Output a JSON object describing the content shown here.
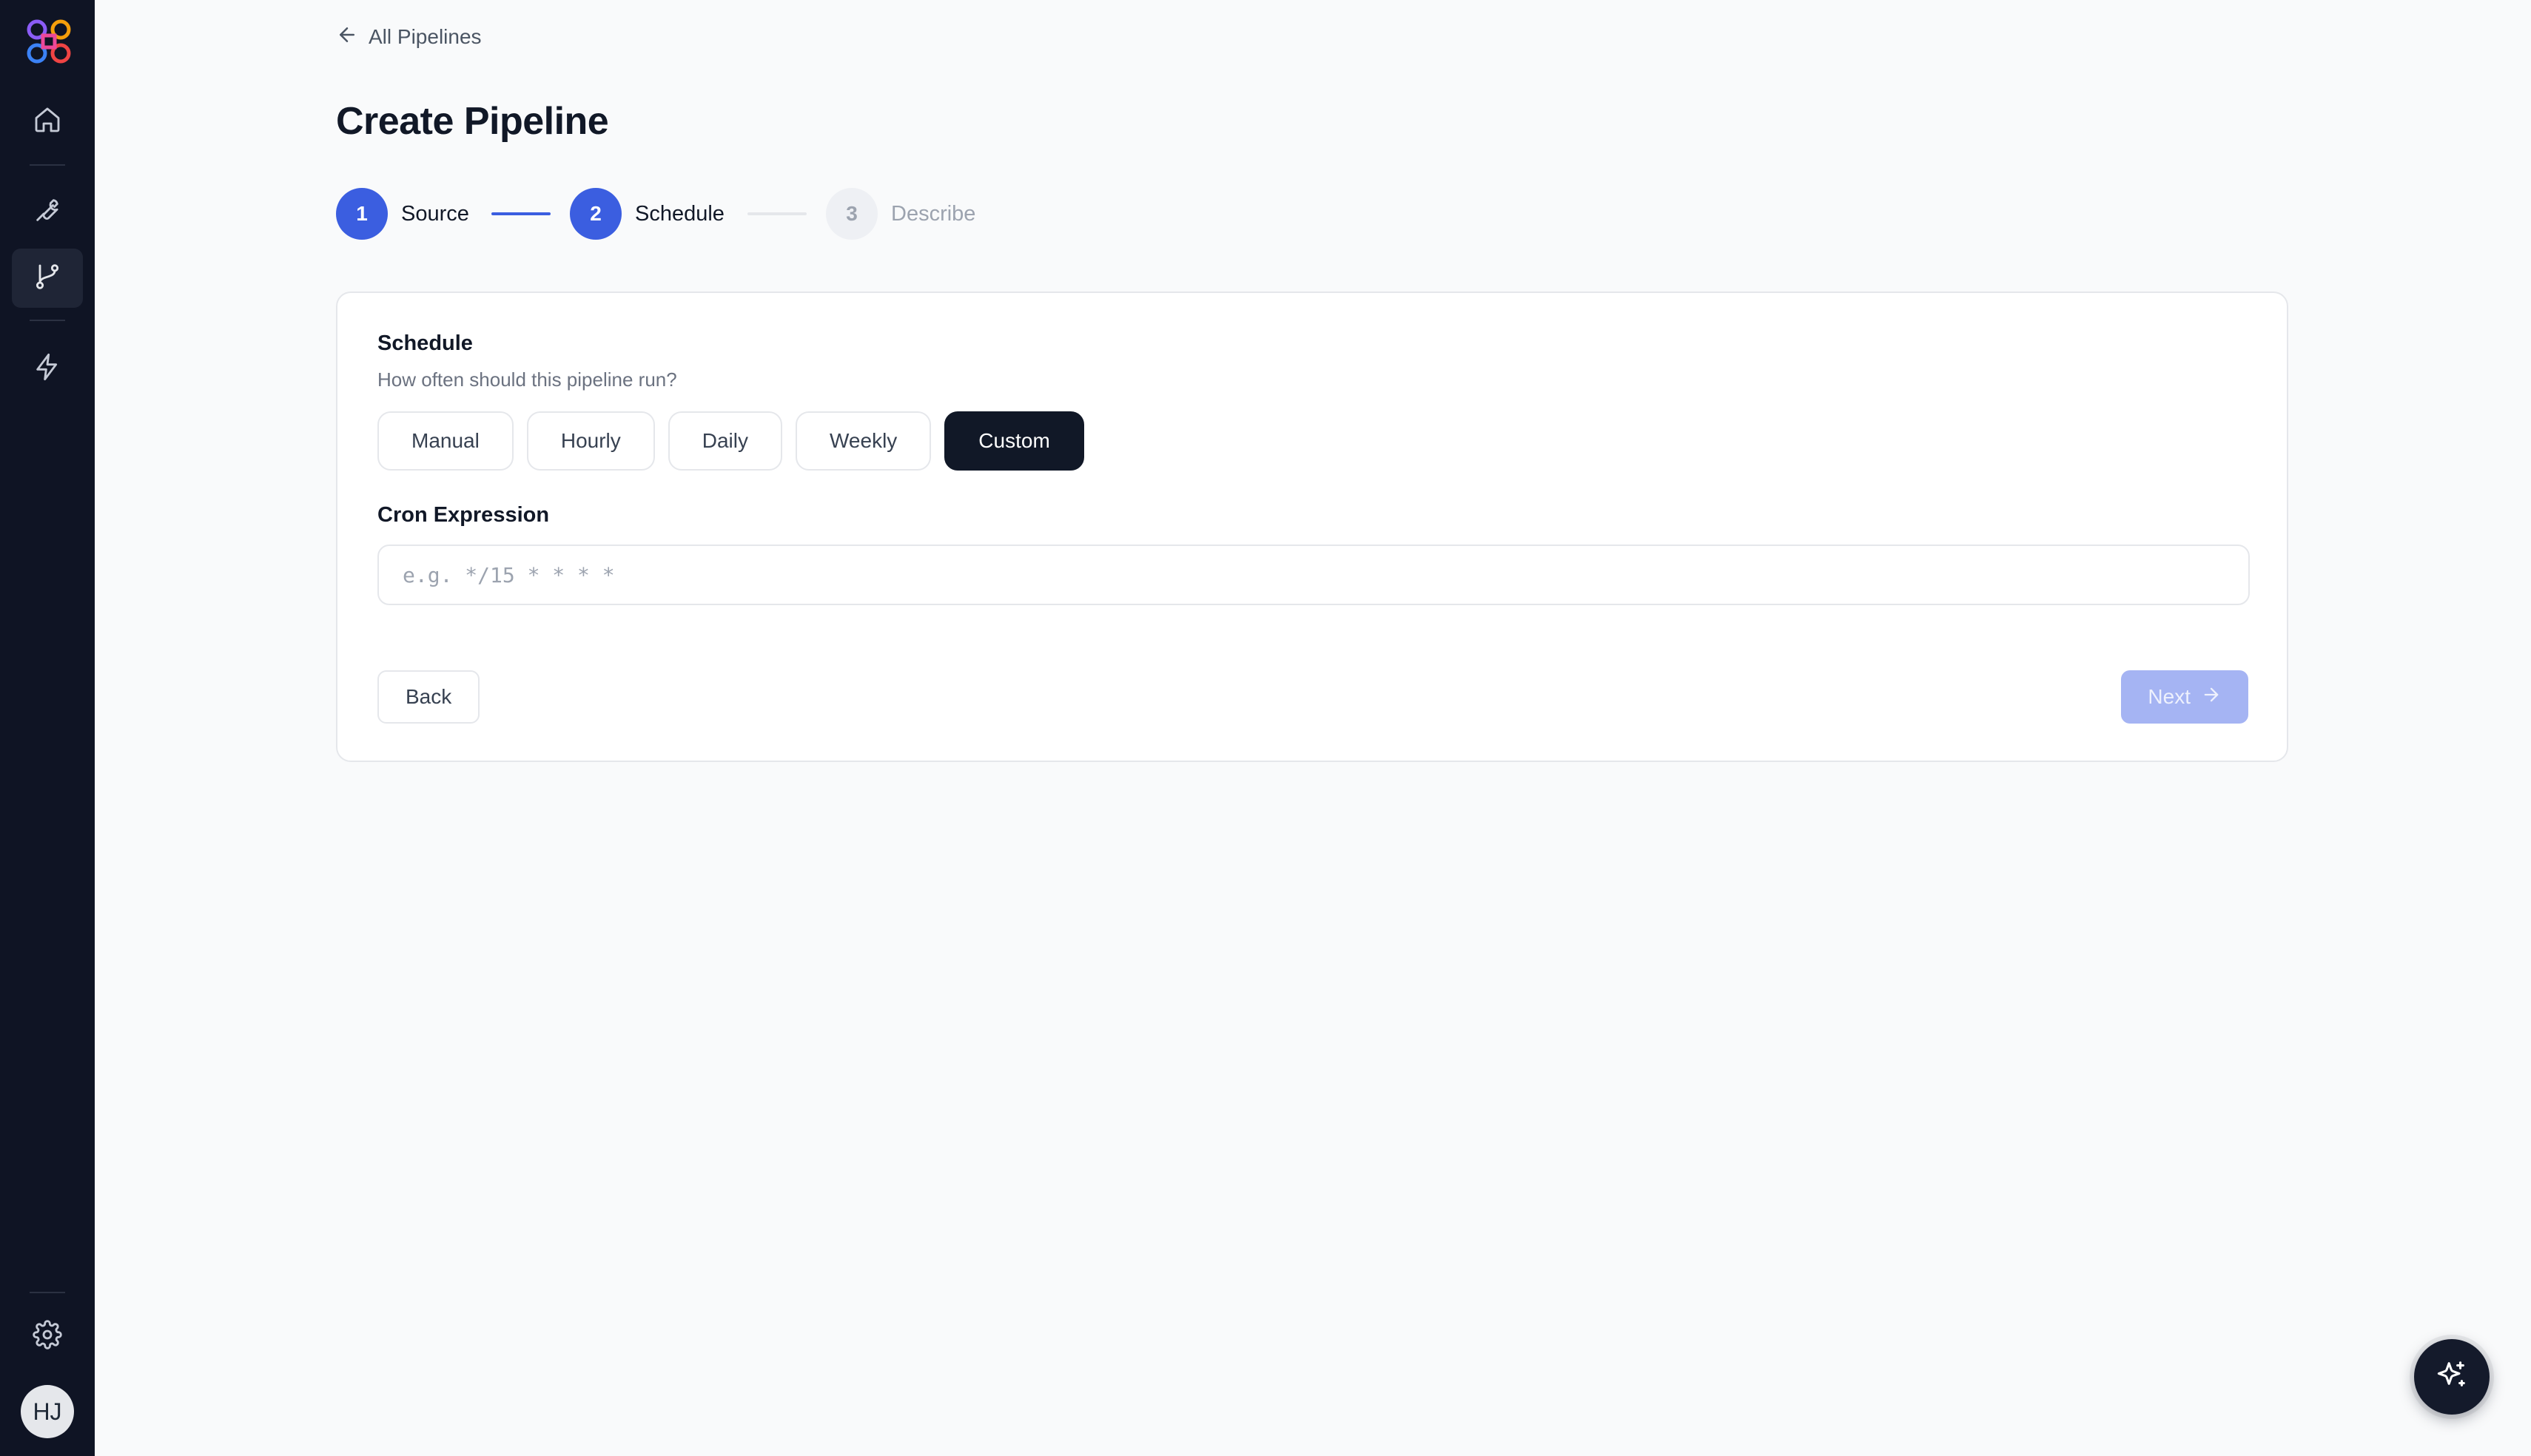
{
  "sidebar": {
    "icons": [
      "logo-icon",
      "home-icon",
      "wrench-icon",
      "git-branch-icon",
      "lightning-icon",
      "gear-icon"
    ],
    "active": "git-branch-icon",
    "avatar_initials": "HJ"
  },
  "header": {
    "back_link": "All Pipelines",
    "title": "Create Pipeline"
  },
  "stepper": {
    "steps": [
      {
        "number": "1",
        "label": "Source",
        "state": "completed"
      },
      {
        "number": "2",
        "label": "Schedule",
        "state": "current"
      },
      {
        "number": "3",
        "label": "Describe",
        "state": "pending"
      }
    ]
  },
  "schedule": {
    "title": "Schedule",
    "subtitle": "How often should this pipeline run?",
    "options": [
      "Manual",
      "Hourly",
      "Daily",
      "Weekly",
      "Custom"
    ],
    "selected": "Custom"
  },
  "cron": {
    "label": "Cron Expression",
    "placeholder": "e.g. */15 * * * *",
    "value": ""
  },
  "actions": {
    "back_label": "Back",
    "next_label": "Next",
    "next_enabled": false
  },
  "fab": {
    "icon": "sparkles-icon"
  },
  "colors": {
    "sidebar_bg": "#0f1424",
    "accent": "#3b5ee0",
    "selected_option": "#111827",
    "next_disabled": "#a5b4f3",
    "page_bg": "#f9fafb"
  }
}
